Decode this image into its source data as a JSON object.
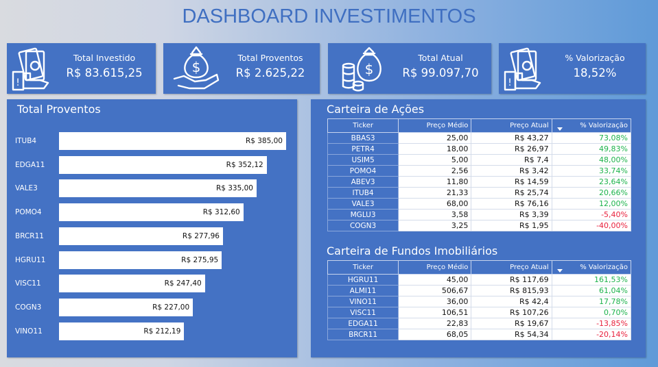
{
  "title": "DASHBOARD INVESTIMENTOS",
  "colors": {
    "panel": "#4472c4",
    "title": "#3f6fc1",
    "positive": "#1db34c",
    "negative": "#e8203c"
  },
  "kpis": [
    {
      "icon": "money-hand-icon",
      "label": "Total Investido",
      "value": "R$ 83.615,25"
    },
    {
      "icon": "money-bag-hand-icon",
      "label": "Total Proventos",
      "value": "R$ 2.625,22"
    },
    {
      "icon": "money-bag-coins-icon",
      "label": "Total Atual",
      "value": "R$ 99.097,70"
    },
    {
      "icon": "money-hand-icon",
      "label": "% Valorização",
      "value": "18,52%"
    }
  ],
  "proventos": {
    "title": "Total Proventos",
    "chart_data": {
      "type": "bar",
      "orientation": "horizontal",
      "categories": [
        "ITUB4",
        "EDGA11",
        "VALE3",
        "POMO4",
        "BRCR11",
        "HGRU11",
        "VISC11",
        "COGN3",
        "VINO11"
      ],
      "values": [
        385.0,
        352.12,
        335.0,
        312.6,
        277.96,
        275.95,
        247.4,
        227.0,
        212.19
      ],
      "labels": [
        "R$ 385,00",
        "R$ 352,12",
        "R$ 335,00",
        "R$ 312,60",
        "R$ 277,96",
        "R$ 275,95",
        "R$ 247,40",
        "R$ 227,00",
        "R$ 212,19"
      ],
      "bar_color": "#ffffff"
    }
  },
  "acoes": {
    "title": "Carteira de Ações",
    "headers": [
      "Ticker",
      "Preço Médio",
      "Preço Atual",
      "% Valorização"
    ],
    "rows": [
      [
        "BBAS3",
        "25,00",
        "R$ 43,27",
        "73,08%"
      ],
      [
        "PETR4",
        "18,00",
        "R$ 26,97",
        "49,83%"
      ],
      [
        "USIM5",
        "5,00",
        "R$ 7,4",
        "48,00%"
      ],
      [
        "POMO4",
        "2,56",
        "R$ 3,42",
        "33,74%"
      ],
      [
        "ABEV3",
        "11,80",
        "R$ 14,59",
        "23,64%"
      ],
      [
        "ITUB4",
        "21,33",
        "R$ 25,74",
        "20,66%"
      ],
      [
        "VALE3",
        "68,00",
        "R$ 76,16",
        "12,00%"
      ],
      [
        "MGLU3",
        "3,58",
        "R$ 3,39",
        "-5,40%"
      ],
      [
        "COGN3",
        "3,25",
        "R$ 1,95",
        "-40,00%"
      ]
    ]
  },
  "fundos": {
    "title": "Carteira de Fundos Imobiliários",
    "headers": [
      "Ticker",
      "Preço Médio",
      "Preço Atual",
      "% Valorização"
    ],
    "rows": [
      [
        "HGRU11",
        "45,00",
        "R$ 117,69",
        "161,53%"
      ],
      [
        "ALMI11",
        "506,67",
        "R$ 815,93",
        "61,04%"
      ],
      [
        "VINO11",
        "36,00",
        "R$ 42,4",
        "17,78%"
      ],
      [
        "VISC11",
        "106,51",
        "R$ 107,26",
        "0,70%"
      ],
      [
        "EDGA11",
        "22,83",
        "R$ 19,67",
        "-13,85%"
      ],
      [
        "BRCR11",
        "68,05",
        "R$ 54,34",
        "-20,14%"
      ]
    ]
  }
}
